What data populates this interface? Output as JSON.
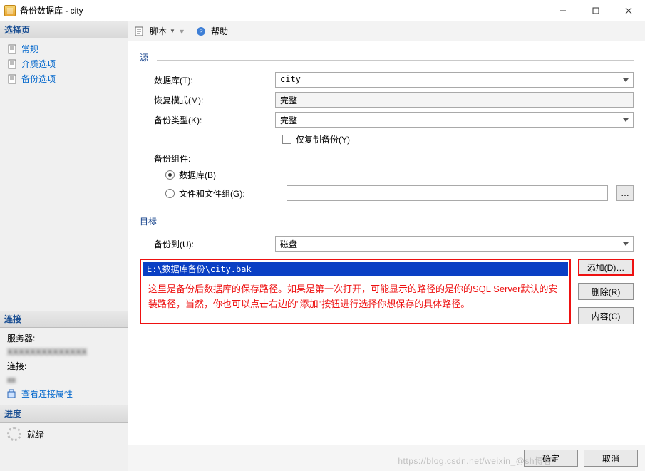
{
  "titlebar": {
    "title": "备份数据库 - city"
  },
  "sidebar": {
    "select_page_header": "选择页",
    "pages": [
      {
        "label": "常规"
      },
      {
        "label": "介质选项"
      },
      {
        "label": "备份选项"
      }
    ],
    "connection_header": "连接",
    "server_label": "服务器:",
    "server_value": "XXXXXXXXXXXXXX",
    "conn_label": "连接:",
    "conn_value": "xx",
    "view_props": "查看连接属性",
    "progress_header": "进度",
    "progress_status": "就绪"
  },
  "toolbar": {
    "script": "脚本",
    "help": "帮助"
  },
  "source": {
    "group": "源",
    "database_label": "数据库(T):",
    "database_value": "city",
    "recovery_label": "恢复模式(M):",
    "recovery_value": "完整",
    "type_label": "备份类型(K):",
    "type_value": "完整",
    "copy_only": "仅复制备份(Y)",
    "component_label": "备份组件:",
    "radio_db": "数据库(B)",
    "radio_fg": "文件和文件组(G):"
  },
  "destination": {
    "group": "目标",
    "backup_to_label": "备份到(U):",
    "backup_to_value": "磁盘",
    "path": "E:\\数据库备份\\city.bak",
    "annotation": "这里是备份后数据库的保存路径。如果是第一次打开，可能显示的路径的是你的SQL Server默认的安装路径，当然，你也可以点击右边的\"添加\"按钮进行选择你想保存的具体路径。",
    "add_btn": "添加(D)…",
    "remove_btn": "删除(R)",
    "content_btn": "内容(C)"
  },
  "footer": {
    "ok": "确定",
    "cancel": "取消",
    "watermark": "https://blog.csdn.net/weixin_@sh博客"
  }
}
